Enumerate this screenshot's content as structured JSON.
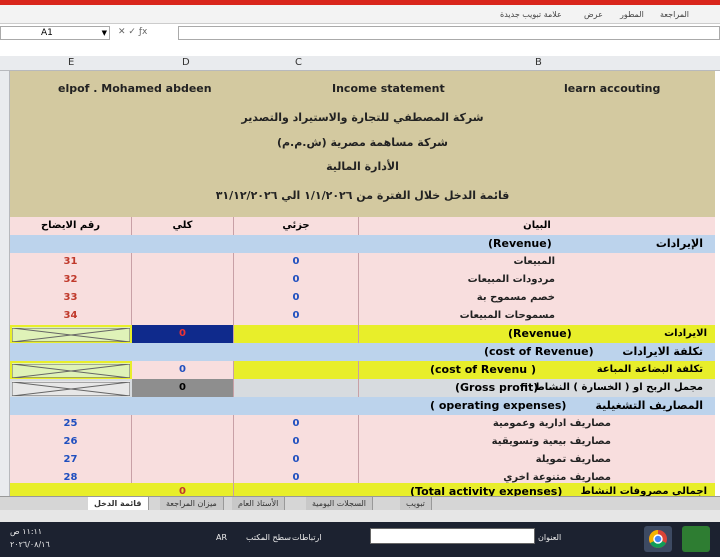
{
  "ribbon": {
    "tabs": [
      "المراجعة",
      "المطور",
      "عرض",
      "علامة تبويب جديدة"
    ]
  },
  "namebox": "A1",
  "columns": [
    "E",
    "D",
    "C",
    "B"
  ],
  "header": {
    "left": "elpof . Mohamed abdeen",
    "center": "Income statement",
    "right": "learn accouting"
  },
  "company": {
    "name1": "شركة المصطفي للتجارة والاستيراد والتصدير",
    "name2": "شركة مساهمة مصرية (ش.م.م)",
    "dept": "الأدارة المالية",
    "period": "قائمة الدخل خلال الفترة من ١/١/٢٠٢٦ الي ٣١/١٢/٢٠٢٦"
  },
  "table_headers": {
    "ref": "رقم الايضاح",
    "total": "كلي",
    "partial": "جزئي",
    "item": "البيان"
  },
  "sections": {
    "revenue_ar": "الإيرادات",
    "revenue_en": "(Revenue)",
    "total_revenue_ar": "الايرادات",
    "total_revenue_en": "(Revenue)",
    "cost_ar": "تكلفة الايرادات",
    "cost_en": "(cost of Revenue)",
    "cost_goods_ar": "تكلفة البضاعة المباعة",
    "cost_goods_en": "(cost of Revenu )",
    "gross_ar": "مجمل الربح او ( الخسارة ) النشاط",
    "gross_en": "(Gross profit)",
    "opex_ar": "المصاريف التشغيلية",
    "opex_en": "( operating expenses)",
    "total_opex_ar": "اجمالي مصروفات النشاط",
    "total_opex_en": "(Total activity expenses)"
  },
  "revenue_rows": [
    {
      "label": "المبيعات",
      "partial": "0",
      "ref": "31"
    },
    {
      "label": "مردودات المبيعات",
      "partial": "0",
      "ref": "32"
    },
    {
      "label": "خصم مسموح بة",
      "partial": "0",
      "ref": "33"
    },
    {
      "label": "مسموحات المبيعات",
      "partial": "0",
      "ref": "34"
    }
  ],
  "totals": {
    "revenue": "0",
    "cost_goods": "0",
    "gross": "0",
    "opex": "0"
  },
  "opex_rows": [
    {
      "label": "مصاريف ادارية وعمومية",
      "partial": "0",
      "ref": "25"
    },
    {
      "label": "مصاريف بيعية وتسويقية",
      "partial": "0",
      "ref": "26"
    },
    {
      "label": "مصاريف تمويلة",
      "partial": "0",
      "ref": "27"
    },
    {
      "label": "مصاريف متنوعة اخري",
      "partial": "0",
      "ref": "28"
    }
  ],
  "sheet_tabs": [
    "قائمة الدخل",
    "ميزان المراجعة",
    "الأستاذ العام",
    "السجلات اليومية",
    "تبويب"
  ],
  "taskbar": {
    "time": "١١:١١ ص",
    "date": "٢٠٢٦/٠٨/١٦",
    "lang": "AR",
    "desktop": "سطح المكتب",
    "links": "ارتباطات",
    "address": "العنوان"
  },
  "colors": {
    "header_band": "#d3c9a0",
    "row_pink": "#f8dede",
    "row_blue": "#bcd3ec",
    "total_yellow": "#e8ee2a",
    "ref_red": "#c0392b",
    "num_blue": "#1f4fbf"
  }
}
